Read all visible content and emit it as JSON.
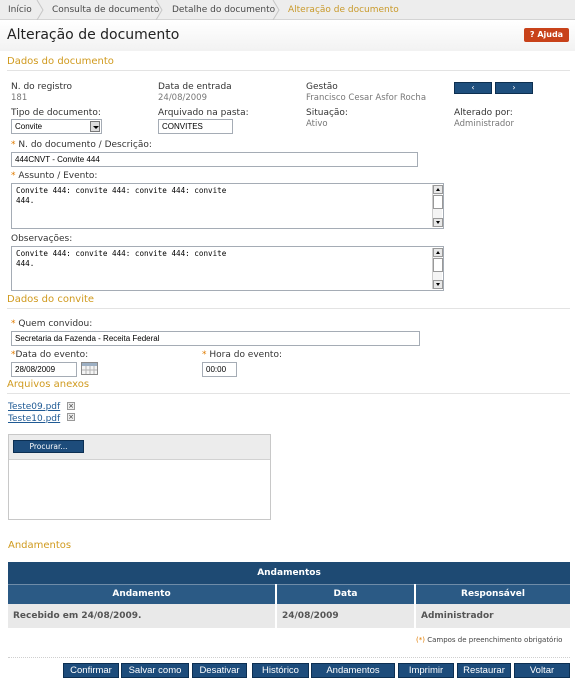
{
  "breadcrumb": [
    "Início",
    "Consulta de documento",
    "Detalhe do documento",
    "Alteração de documento"
  ],
  "page_title": "Alteração de documento",
  "help_label": "Ajuda",
  "sections": {
    "dados_documento": "Dados do documento",
    "dados_convite": "Dados do convite",
    "arquivos_anexos": "Arquivos anexos",
    "andamentos": "Andamentos"
  },
  "document": {
    "registro_label": "N. do registro",
    "registro_value": "181",
    "entrada_label": "Data de entrada",
    "entrada_value": "24/08/2009",
    "gestao_label": "Gestão",
    "gestao_value": "Francisco Cesar Asfor Rocha",
    "tipo_label": "Tipo de documento:",
    "tipo_value": "Convite",
    "pasta_label": "Arquivado na pasta:",
    "pasta_value": "CONVITES",
    "situacao_label": "Situação:",
    "situacao_value": "Ativo",
    "alterado_label": "Alterado por:",
    "alterado_value": "Administrador",
    "numero_label": "N. do documento / Descrição:",
    "numero_value": "444CNVT - Convite 444",
    "assunto_label": "Assunto / Evento:",
    "assunto_value": "Convite 444: convite 444: convite 444: convite\n444.",
    "observacoes_label": "Observações:",
    "observacoes_value": "Convite 444: convite 444: convite 444: convite\n444."
  },
  "nav": {
    "prev": "‹",
    "next": "›"
  },
  "convite": {
    "quem_label": "Quem convidou:",
    "quem_value": "Secretaria da Fazenda - Receita Federal",
    "data_label": "Data do evento:",
    "data_value": "28/08/2009",
    "hora_label": "Hora do evento:",
    "hora_value": "00:00"
  },
  "attachments": [
    "Teste09.pdf",
    "Teste10.pdf"
  ],
  "upload_button": "Procurar...",
  "andamentos_table": {
    "caption": "Andamentos",
    "headers": [
      "Andamento",
      "Data",
      "Responsável"
    ],
    "rows": [
      [
        "Recebido em 24/08/2009.",
        "24/08/2009",
        "Administrador"
      ]
    ]
  },
  "required_note": "Campos de preenchimento obrigatório",
  "required_marker": "(*)",
  "buttons": [
    "Confirmar",
    "Salvar como",
    "Desativar",
    "Histórico",
    "Andamentos",
    "Imprimir",
    "Restaurar",
    "Voltar"
  ],
  "colors": {
    "accent": "#d09a1e",
    "button": "#1d4c7b",
    "required": "#e07c00"
  }
}
